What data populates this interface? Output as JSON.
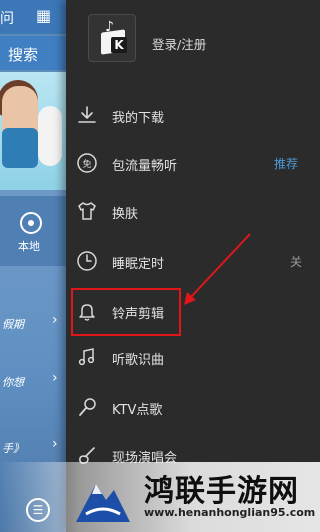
{
  "background_app": {
    "topbar": {
      "left_text": "问",
      "grid_icon": "grid-icon"
    },
    "search_label": "搜索",
    "local_label": "本地",
    "rows": [
      {
        "text": "假期",
        "chevron": "›"
      },
      {
        "text": "你想",
        "chevron": "›"
      },
      {
        "text": "手》",
        "chevron": "›"
      }
    ]
  },
  "drawer": {
    "profile": {
      "login_text": "登录/注册",
      "logo_icon": "kugou-logo-icon"
    },
    "items": [
      {
        "icon": "download-icon",
        "label": "我的下载"
      },
      {
        "icon": "data-plan-icon",
        "label": "包流量畅听",
        "badge": "推荐"
      },
      {
        "icon": "tshirt-skin-icon",
        "label": "换肤"
      },
      {
        "icon": "clock-icon",
        "label": "睡眠定时",
        "status": "关"
      },
      {
        "icon": "bell-icon",
        "label": "铃声剪辑"
      },
      {
        "icon": "music-note-icon",
        "label": "听歌识曲"
      },
      {
        "icon": "microphone-icon",
        "label": "KTV点歌"
      },
      {
        "icon": "guitar-icon",
        "label": "现场演唱会"
      }
    ]
  },
  "annotation": {
    "highlight_color": "#e0161b"
  },
  "watermark": {
    "title": "鸿联手游网",
    "url": "www.henanhonglian95.com"
  }
}
